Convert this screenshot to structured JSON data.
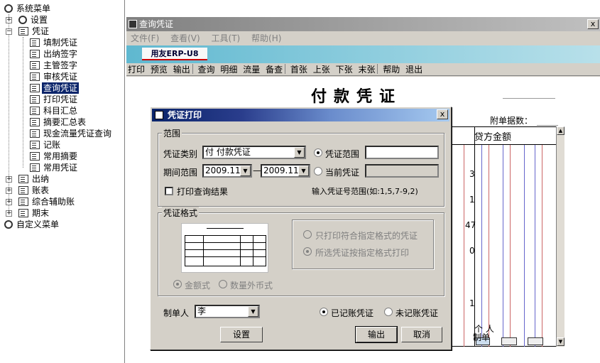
{
  "tree": {
    "root": "系统菜单",
    "items": [
      {
        "label": "设置"
      },
      {
        "label": "凭证"
      },
      {
        "label": "填制凭证"
      },
      {
        "label": "出纳签字"
      },
      {
        "label": "主管签字"
      },
      {
        "label": "审核凭证"
      },
      {
        "label": "查询凭证",
        "selected": true
      },
      {
        "label": "打印凭证"
      },
      {
        "label": "科目汇总"
      },
      {
        "label": "摘要汇总表"
      },
      {
        "label": "现金流量凭证查询"
      },
      {
        "label": "记账"
      },
      {
        "label": "常用摘要"
      },
      {
        "label": "常用凭证"
      },
      {
        "label": "出纳"
      },
      {
        "label": "账表"
      },
      {
        "label": "综合辅助账"
      },
      {
        "label": "期末"
      },
      {
        "label": "自定义菜单"
      }
    ]
  },
  "window": {
    "title": "查询凭证",
    "close": "x",
    "menu": [
      "文件(F)",
      "查看(V)",
      "工具(T)",
      "帮助(H)"
    ],
    "logo": "用友ERP-U8",
    "toolbar": [
      "打印",
      "预览",
      "输出",
      "查询",
      "明细",
      "流量",
      "备查",
      "首张",
      "上张",
      "下张",
      "末张",
      "帮助",
      "退出"
    ]
  },
  "voucher": {
    "title": "付款凭证",
    "attachments_label": "附单据数：",
    "credit_header": "贷方金额",
    "preparer_label": "制单",
    "person_label": "个 人",
    "row_digits": [
      "3",
      "1",
      "47",
      "0",
      "1"
    ]
  },
  "dialog": {
    "title": "凭证打印",
    "close": "x",
    "range_group": "范围",
    "type_label": "凭证类别",
    "type_value": "付  付款凭证",
    "range_radio": "凭证范围",
    "period_label": "期间范围",
    "period_from": "2009.11",
    "period_dash": "—",
    "period_to": "2009.11",
    "current_radio": "当前凭证",
    "print_result_check": "打印查询结果",
    "range_hint": "输入凭证号范围(如:1,5,7-9,2)",
    "format_group": "凭证格式",
    "only_matching_radio": "只打印符合指定格式的凭证",
    "all_format_radio": "所选凭证按指定格式打印",
    "amount_radio": "金额式",
    "quantity_radio": "数量外币式",
    "maker_label": "制单人",
    "maker_value": "李",
    "posted_radio": "已记账凭证",
    "unposted_radio": "未记账凭证",
    "settings_btn": "设置",
    "output_btn": "输出",
    "cancel_btn": "取消"
  }
}
